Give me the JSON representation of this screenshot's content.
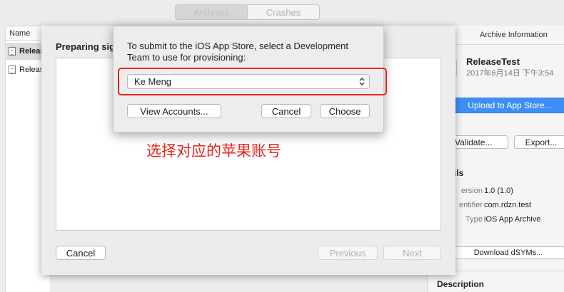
{
  "window": {
    "tabs": [
      {
        "label": "Archives",
        "selected": true
      },
      {
        "label": "Crashes",
        "selected": false
      }
    ]
  },
  "archive_list": {
    "column_header": "Name",
    "rows": [
      {
        "label": "Releas",
        "selected": true
      },
      {
        "label": "Releas",
        "selected": false
      }
    ]
  },
  "info_panel": {
    "header": "Archive Information",
    "archive_name": "ReleaseTest",
    "archive_date": "2017年6月14日 下午3:54",
    "upload_button": "Upload to App Store...",
    "validate_button": "Validate...",
    "export_button": "Export...",
    "details_heading": "ils",
    "details": [
      {
        "key": "ersion",
        "value": "1.0 (1.0)"
      },
      {
        "key": "entifier",
        "value": "com.rdzn.test"
      },
      {
        "key": "Type",
        "value": "iOS App Archive"
      }
    ],
    "download_dsyms_button": "Download dSYMs...",
    "description_heading": "Description"
  },
  "sheet": {
    "title": "Preparing sig",
    "cancel_button": "Cancel",
    "previous_button": "Previous",
    "next_button": "Next"
  },
  "popover": {
    "message": "To submit to the iOS App Store, select a Development Team to use for provisioning:",
    "team_select_value": "Ke Meng",
    "view_accounts_button": "View Accounts...",
    "cancel_button": "Cancel",
    "choose_button": "Choose"
  },
  "annotation": {
    "text": "选择对应的苹果账号",
    "color": "#e8261c"
  },
  "colors": {
    "accent_blue": "#3d8ff7",
    "annotation_red": "#e8261c"
  }
}
